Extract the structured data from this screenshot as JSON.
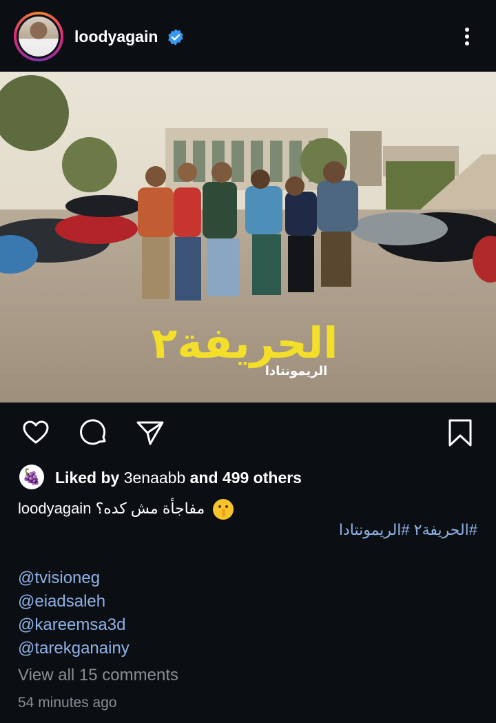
{
  "header": {
    "username": "loodyagain",
    "verified": true
  },
  "post": {
    "image_overlay_title": "الحريفة٢",
    "image_overlay_subtitle": "الريمونتادا"
  },
  "actions": {
    "like_icon": "heart-icon",
    "comment_icon": "comment-icon",
    "share_icon": "send-icon",
    "save_icon": "bookmark-icon"
  },
  "likes": {
    "prefix": "Liked by ",
    "user": "3enaabb",
    "middle": " and ",
    "others": "499 others",
    "avatar_emoji": "🍇"
  },
  "caption": {
    "username": "loodyagain",
    "text": "مفاجأة مش كده؟",
    "hashtags": "#الحريفة٢ #الريمونتادا",
    "mentions": [
      "@tvisioneg",
      "@eiadsaleh",
      "@kareemsa3d",
      "@tarekganainy"
    ]
  },
  "comments": {
    "view_all": "View all 15 comments"
  },
  "timestamp": "54 minutes ago",
  "colors": {
    "background": "#0b0f14",
    "link": "#8fb2e6",
    "muted": "#8a8d92",
    "verified": "#3897f0"
  }
}
